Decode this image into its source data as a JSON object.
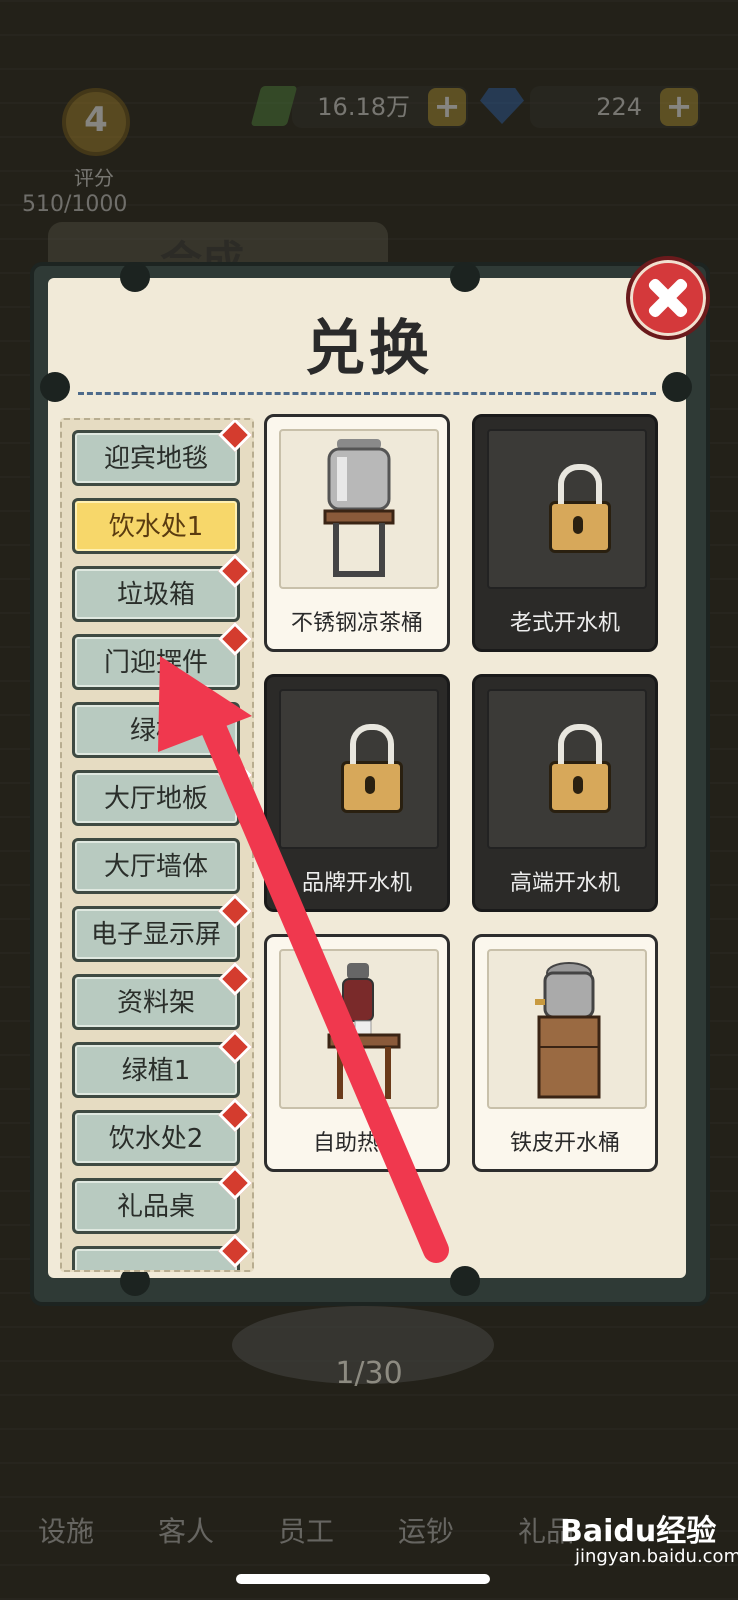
{
  "hud": {
    "level": "4",
    "level_label": "评分",
    "score": "510/1000",
    "money": "16.18万",
    "gems": "224"
  },
  "bg_tab_title": "合成",
  "modal": {
    "title": "兑换",
    "categories": [
      {
        "label": "迎宾地毯",
        "badge": true
      },
      {
        "label": "饮水处1",
        "active": true
      },
      {
        "label": "垃圾箱",
        "badge": true
      },
      {
        "label": "门迎摆件",
        "badge": true
      },
      {
        "label": "绿植",
        "badge": false
      },
      {
        "label": "大厅地板",
        "badge": true
      },
      {
        "label": "大厅墙体",
        "badge": false
      },
      {
        "label": "电子显示屏",
        "badge": true
      },
      {
        "label": "资料架",
        "badge": true
      },
      {
        "label": "绿植1",
        "badge": true
      },
      {
        "label": "饮水处2",
        "badge": true
      },
      {
        "label": "礼品桌",
        "badge": true
      }
    ],
    "items": [
      {
        "name": "不锈钢凉茶桶",
        "locked": false
      },
      {
        "name": "老式开水机",
        "locked": true
      },
      {
        "name": "品牌开水机",
        "locked": true
      },
      {
        "name": "高端开水机",
        "locked": true
      },
      {
        "name": "自助热水",
        "locked": false
      },
      {
        "name": "铁皮开水桶",
        "locked": false
      }
    ]
  },
  "page_indicator": "1/30",
  "tabs": [
    "设施",
    "客人",
    "员工",
    "运钞",
    "礼品"
  ],
  "watermark": {
    "brand": "Baidu经验",
    "url": "jingyan.baidu.com"
  },
  "colors": {
    "accent_red": "#d4393b",
    "active_yellow": "#f7d76a",
    "arrow": "#f0384e"
  }
}
